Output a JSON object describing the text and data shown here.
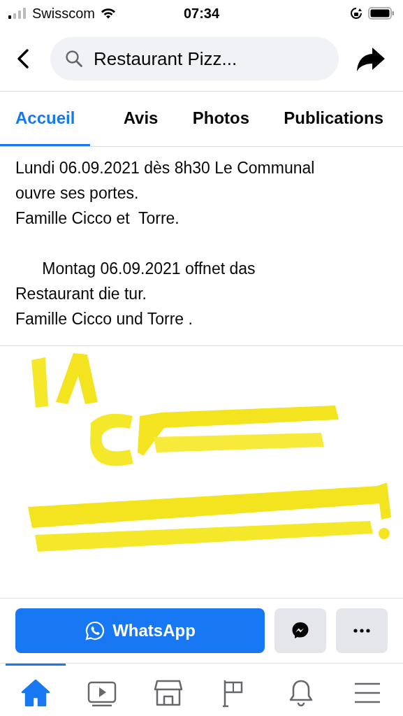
{
  "status_bar": {
    "carrier": "Swisscom",
    "time": "07:34"
  },
  "header": {
    "search": {
      "value": "Restaurant Pizz..."
    }
  },
  "tabs": [
    {
      "label": "Accueil",
      "selected": true
    },
    {
      "label": "Avis",
      "selected": false
    },
    {
      "label": "Photos",
      "selected": false
    },
    {
      "label": "Publications",
      "selected": false
    }
  ],
  "post": {
    "paragraphs": [
      [
        "Lundi 06.09.2021 dès 8h30 Le Communal",
        "ouvre ses portes.",
        "Famille Cicco et  Torre."
      ],
      [
        "      Montag 06.09.2021 offnet das",
        "Restaurant die tur.",
        "Famille Cicco und Torre ."
      ]
    ],
    "image": {
      "kind": "picture"
    }
  },
  "actions": {
    "primary": "WhatsApp"
  },
  "bottom_nav": [
    {
      "kind": "home",
      "selected": true
    },
    {
      "kind": "video",
      "selected": false
    },
    {
      "kind": "shop",
      "selected": false
    },
    {
      "kind": "flag",
      "selected": false
    },
    {
      "kind": "bell",
      "selected": false
    },
    {
      "kind": "menu",
      "selected": false
    }
  ]
}
